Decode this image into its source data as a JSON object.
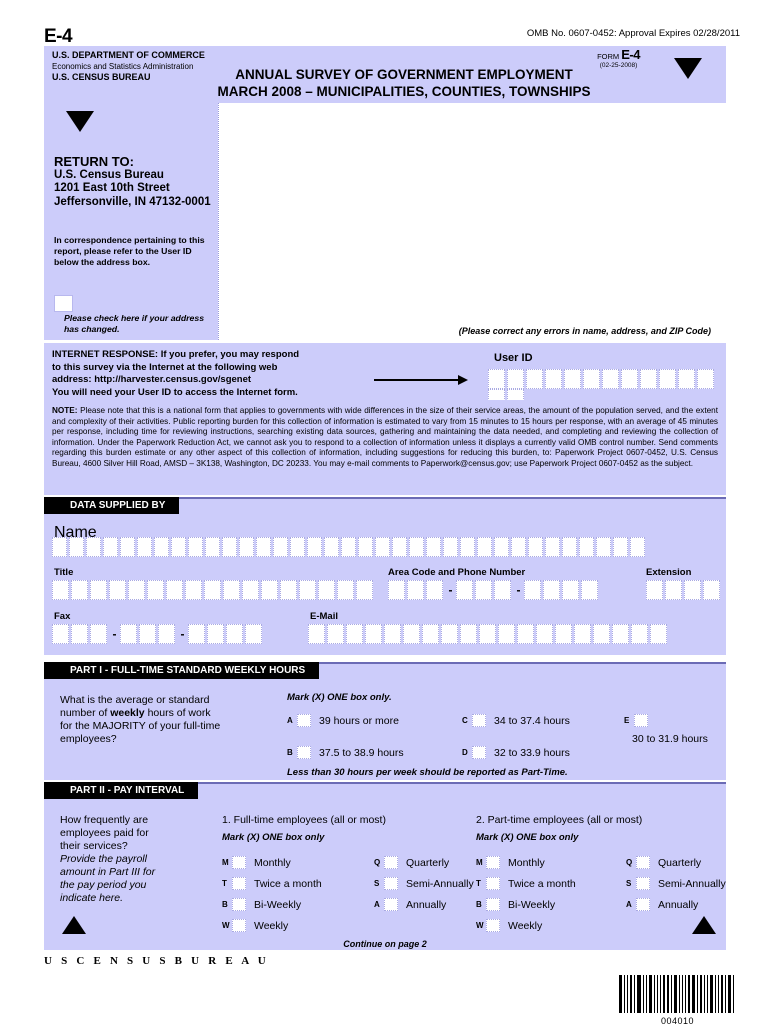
{
  "form_number": "E-4",
  "omb_line": "OMB No. 0607-0452:  Approval Expires 02/28/2011",
  "header": {
    "agency_line1": "U.S. DEPARTMENT OF COMMERCE",
    "agency_line2": "Economics and Statistics Administration",
    "agency_line3": "U.S. CENSUS BUREAU",
    "title_line1": "ANNUAL SURVEY OF GOVERNMENT EMPLOYMENT",
    "title_line2": "MARCH 2008 – MUNICIPALITIES, COUNTIES, TOWNSHIPS",
    "form_label": "FORM",
    "form_code": "E-4",
    "form_date": "(02-25-2008)"
  },
  "return_to": {
    "heading": "RETURN TO:",
    "line1": "U.S. Census Bureau",
    "line2": "1201 East 10th Street",
    "line3": "Jeffersonville, IN  47132-0001",
    "correspondence_note": "In correspondence pertaining to this report, please refer to the User ID below the address box.",
    "address_change_label": "Please check here if your address has changed.",
    "correct_errors_note": "(Please correct any errors in name, address, and ZIP Code)"
  },
  "internet": {
    "line1": "INTERNET RESPONSE: If you prefer, you may respond",
    "line2": "to this survey via the Internet at the following web",
    "line3": "address: http://harvester.census.gov/sgenet",
    "line4": "You will need your User ID to access the Internet form.",
    "user_id_label": "User ID",
    "user_id_boxes": 14
  },
  "note": {
    "label": "NOTE:",
    "text": " Please note that this is a national form that applies to governments with wide differences in the size of their service areas, the amount of the population served, and the extent and complexity of their activities. Public reporting burden for this collection of information is estimated to vary from 15 minutes to 15 hours per response, with an average of 45 minutes per response, including time for reviewing instructions, searching existing data sources, gathering and maintaining the data needed, and completing and reviewing the collection of information. Under the Paperwork Reduction Act, we cannot ask you to respond to a collection of information unless it displays a currently valid OMB control number. Send comments regarding this burden estimate or any other aspect of this collection of information, including suggestions for reducing this burden, to: Paperwork Project 0607-0452, U.S. Census Bureau, 4600 Silver Hill Road, AMSD – 3K138, Washington, DC 20233. You may e-mail comments to Paperwork@census.gov; use Paperwork Project 0607-0452 as the subject."
  },
  "data_supplied_by": {
    "section_title": "DATA SUPPLIED BY",
    "name_label": "Name",
    "name_boxes": 35,
    "title_label": "Title",
    "title_boxes": 17,
    "phone_label": "Area Code and Phone Number",
    "phone_groups": [
      3,
      3,
      4
    ],
    "phone_separator": "-",
    "extension_label": "Extension",
    "extension_boxes": 4,
    "fax_label": "Fax",
    "fax_groups": [
      3,
      3,
      4
    ],
    "email_label": "E-Mail",
    "email_boxes": 19
  },
  "part1": {
    "section_title": "PART I - FULL-TIME STANDARD WEEKLY HOURS",
    "question_line1": "What is the average or standard",
    "question_line2_pre": "number of ",
    "question_line2_bold": "weekly",
    "question_line2_post": " hours of work",
    "question_line3": "for the MAJORITY of your full-time",
    "question_line4": "employees?",
    "mark_instruction": "Mark (X) ONE box only.",
    "options": [
      {
        "letter": "A",
        "label": "39 hours or more"
      },
      {
        "letter": "B",
        "label": "37.5 to 38.9 hours"
      },
      {
        "letter": "C",
        "label": "34 to 37.4 hours"
      },
      {
        "letter": "D",
        "label": "32 to 33.9 hours"
      },
      {
        "letter": "E",
        "label": "30 to 31.9 hours"
      }
    ],
    "footnote": "Less than 30 hours per week should be reported as Part-Time."
  },
  "part2": {
    "section_title": "PART II - PAY INTERVAL",
    "question_line1": "How frequently are",
    "question_line2": "employees paid for",
    "question_line3": "their services?",
    "italic_line1": "Provide the payroll",
    "italic_line2": "amount in Part III for",
    "italic_line3": "the pay period you",
    "italic_line4": "indicate here.",
    "col1_heading": "1.  Full-time employees (all or most)",
    "col2_heading": "2.  Part-time employees (all or most)",
    "mark_instruction": "Mark (X) ONE box only",
    "left_options": [
      {
        "letter": "M",
        "label": "Monthly"
      },
      {
        "letter": "T",
        "label": "Twice a month"
      },
      {
        "letter": "B",
        "label": "Bi-Weekly"
      },
      {
        "letter": "W",
        "label": "Weekly"
      }
    ],
    "right_options": [
      {
        "letter": "Q",
        "label": "Quarterly"
      },
      {
        "letter": "S",
        "label": "Semi-Annually"
      },
      {
        "letter": "A",
        "label": "Annually"
      }
    ]
  },
  "footer": {
    "continue_text": "Continue on page 2",
    "logo_text": "U S C E N S U S B U R E A U",
    "barcode_number": "004010",
    "barcode_pattern": [
      3,
      1,
      1,
      2,
      1,
      4,
      1,
      1,
      3,
      1,
      1,
      1,
      2,
      2,
      1,
      3,
      1,
      1,
      1,
      2,
      3,
      1,
      2,
      1,
      1,
      3,
      1,
      1,
      2,
      1,
      3,
      1
    ]
  },
  "colors": {
    "lavender": "#ccccfa",
    "section_bar": "#000000",
    "box_border": "#a9a9e2"
  }
}
